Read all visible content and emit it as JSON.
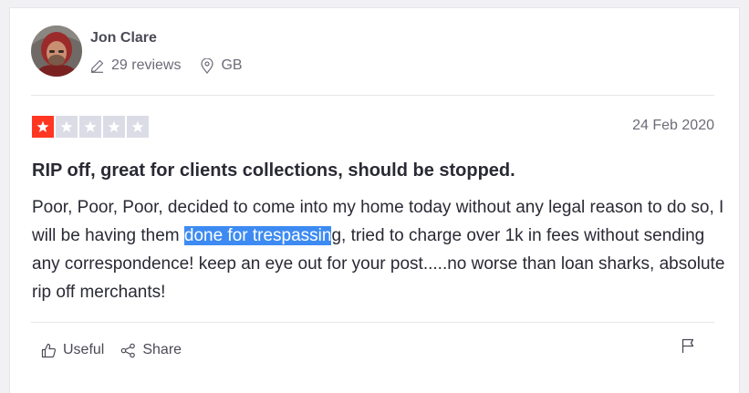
{
  "reviewer": {
    "name": "Jon Clare",
    "reviews_count": "29 reviews",
    "country": "GB",
    "avatar_icon": "user-avatar-photo",
    "count_icon": "pencil-icon",
    "location_icon": "location-pin-icon"
  },
  "review": {
    "rating": 1,
    "max_rating": 5,
    "star_color": "#ff3722",
    "empty_star_color": "#dcdce6",
    "date": "24 Feb 2020",
    "title": "RIP off, great for clients collections, should be stopped.",
    "body": {
      "before": "Poor, Poor, Poor, decided to come into my home today without any legal reason to do so, I will be having them ",
      "selected": "done for trespassin",
      "after": "g, tried to charge over 1k in fees without sending any correspondence! keep an eye out for your post.....no worse than loan sharks, absolute rip off merchants!"
    },
    "selection_color": "#3d8bf2"
  },
  "actions": {
    "useful_label": "Useful",
    "share_label": "Share",
    "useful_icon": "thumbs-up-icon",
    "share_icon": "share-icon",
    "flag_icon": "flag-icon"
  }
}
